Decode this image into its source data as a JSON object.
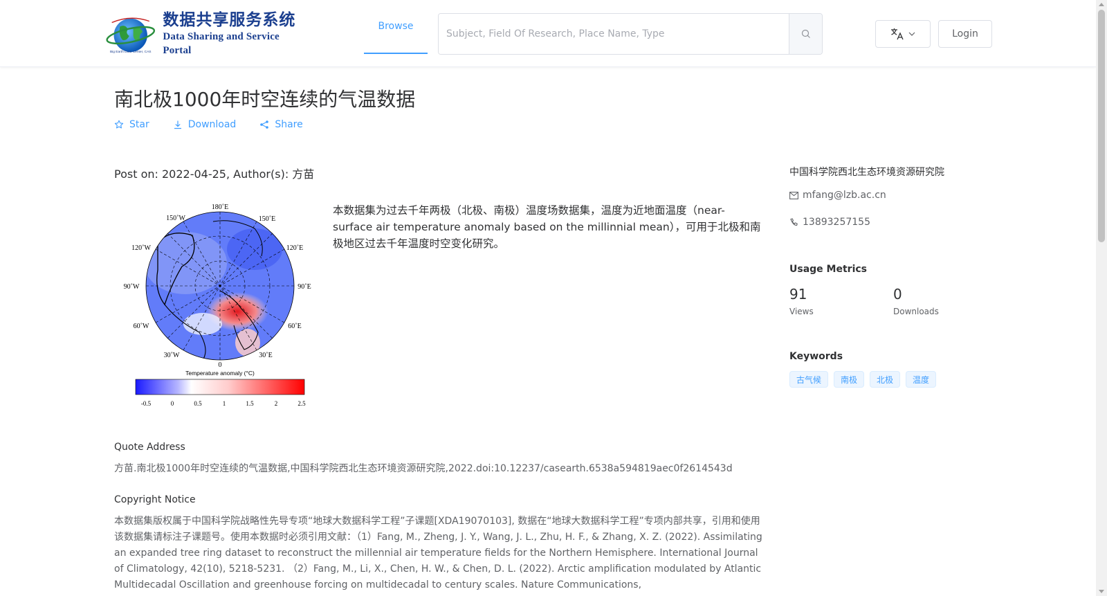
{
  "header": {
    "logo_cn": "数据共享服务系统",
    "logo_en": "Data Sharing and Service Portal",
    "logo_small_cn": "地球大数据科学数据中心",
    "logo_small_en": "Big Earth Data Center, CAS",
    "nav_browse": "Browse",
    "search_placeholder": "Subject, Field Of Research, Place Name, Type",
    "login_label": "Login"
  },
  "dataset": {
    "title": "南北极1000年时空连续的气温数据",
    "actions": {
      "star": "Star",
      "download": "Download",
      "share": "Share"
    },
    "post_line": "Post on: 2022-04-25, Author(s): 方苗",
    "description": "本数据集为过去千年两极（北极、南极）温度场数据集，温度为近地面温度（near-surface air temperature anomaly based on the millinnial mean），可用于北极和南极地区过去千年温度时空变化研究。",
    "quote_label": "Quote Address",
    "quote_text": "方苗.南北极1000年时空连续的气温数据,中国科学院西北生态环境资源研究院,2022.doi:10.12237/casearth.6538a594819aec0f2614543d",
    "copyright_label": "Copyright Notice",
    "copyright_text": "本数据集版权属于中国科学院战略性先导专项“地球大数据科学工程”子课题[XDA19070103], 数据在“地球大数据科学工程”专项内部共享，引用和使用该数据集请标注子课题号。使用本数据时必须引用文献：（1）Fang, M., Zheng, J. Y., Wang, J. L., Zhu, H. F., & Zhang, X. Z. (2022). Assimilating an expanded tree ring dataset to reconstruct the millennial air temperature fields for the Northern Hemisphere. International Journal of Climatology, 42(10), 5218-5231. （2）Fang, M., Li, X., Chen, H. W., & Chen, D. L. (2022). Arctic amplification modulated by Atlantic Multidecadal Oscillation and greenhouse forcing on multidecadal to century scales. Nature Communications,"
  },
  "figure": {
    "lon_labels": [
      "180˚E",
      "150˚W",
      "150˚E",
      "120˚W",
      "120˚E",
      "90˚W",
      "90˚E",
      "60˚W",
      "60˚E",
      "30˚W",
      "30˚E",
      "0"
    ],
    "colorbar_title": "Temperature anomaly (°C)",
    "colorbar_ticks": [
      "-0.5",
      "0",
      "0.5",
      "1",
      "1.5",
      "2",
      "2.5"
    ]
  },
  "sidebar": {
    "institution": "中国科学院西北生态环境资源研究院",
    "email": "mfang@lzb.ac.cn",
    "phone": "13893257155",
    "usage_title": "Usage Metrics",
    "views_value": "91",
    "views_label": "Views",
    "downloads_value": "0",
    "downloads_label": "Downloads",
    "keywords_title": "Keywords",
    "keywords": [
      "古气候",
      "南极",
      "北极",
      "温度"
    ]
  },
  "colors": {
    "accent": "#409eff",
    "brand": "#1b3f8f"
  }
}
